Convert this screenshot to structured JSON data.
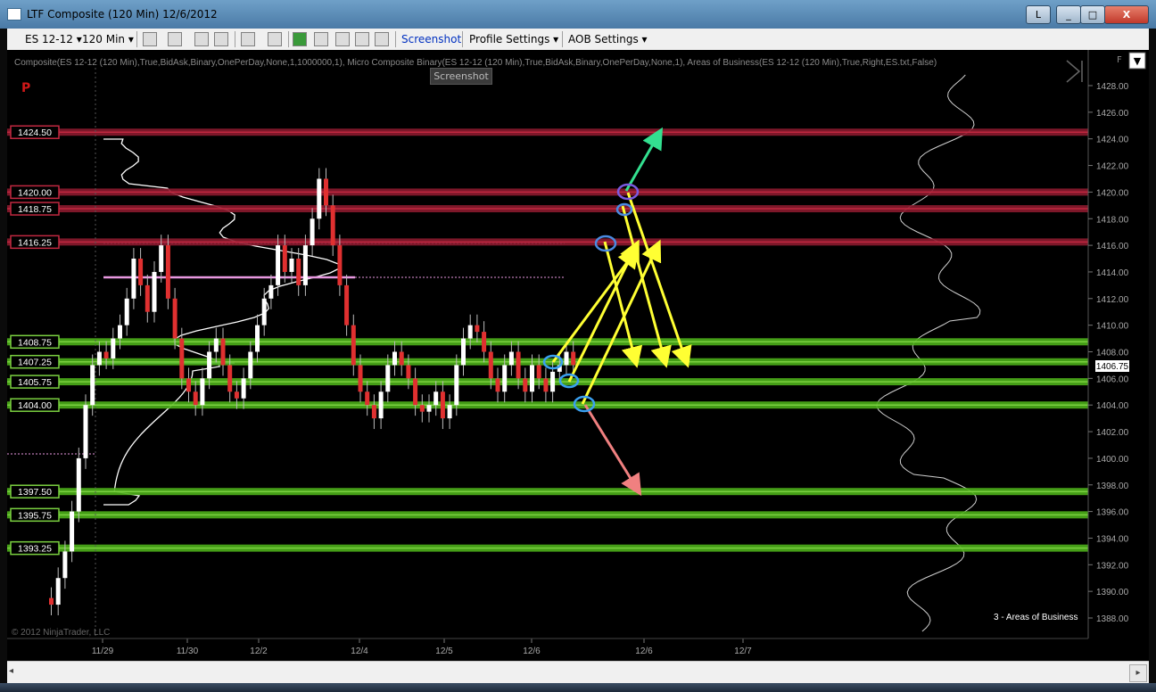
{
  "window": {
    "title": "LTF Composite (120 Min)  12/6/2012",
    "controls": [
      "L",
      "_",
      "□",
      "X"
    ]
  },
  "toolbar": {
    "instrument": "ES 12-12",
    "interval": "120 Min",
    "screenshot_label": "Screenshot",
    "profile_settings_label": "Profile Settings",
    "aob_settings_label": "AOB Settings"
  },
  "chart": {
    "indicator_text": "Composite(ES 12-12 (120 Min),True,BidAsk,Binary,OnePerDay,None,1,1000000,1), Micro Composite Binary(ES 12-12 (120 Min),True,BidAsk,Binary,OnePerDay,None,1), Areas of Business(ES 12-12 (120 Min),True,Right,ES.txt,False)",
    "tooltip": "Screenshot",
    "copyright": "© 2012 NinjaTrader, LLC",
    "panel_label": "3 - Areas of Business",
    "p_badge": "P",
    "f_badge": "F",
    "last_price": "1406.75",
    "date_labels": [
      "11/29",
      "11/30",
      "12/2",
      "12/4",
      "12/5",
      "12/6",
      "12/6",
      "12/7"
    ],
    "price_axis": [
      "1428.00",
      "1426.00",
      "1424.00",
      "1422.00",
      "1420.00",
      "1418.00",
      "1416.00",
      "1414.00",
      "1412.00",
      "1410.00",
      "1408.00",
      "1406.00",
      "1404.00",
      "1402.00",
      "1400.00",
      "1398.00",
      "1396.00",
      "1394.00",
      "1392.00",
      "1390.00",
      "1388.00"
    ],
    "resistance_levels": [
      {
        "label": "1424.50",
        "price": 1424.5
      },
      {
        "label": "1420.00",
        "price": 1420.0
      },
      {
        "label": "1418.75",
        "price": 1418.75
      },
      {
        "label": "1416.25",
        "price": 1416.25
      }
    ],
    "support_levels": [
      {
        "label": "1408.75",
        "price": 1408.75
      },
      {
        "label": "1407.25",
        "price": 1407.25
      },
      {
        "label": "1405.75",
        "price": 1405.75
      },
      {
        "label": "1404.00",
        "price": 1404.0
      },
      {
        "label": "1397.50",
        "price": 1397.5
      },
      {
        "label": "1395.75",
        "price": 1395.75
      },
      {
        "label": "1393.25",
        "price": 1393.25
      }
    ],
    "colors": {
      "resistance": "#8b1a2e",
      "support": "#4caf1a",
      "bull": "#ffffff",
      "bear": "#e03030",
      "scenario": "#ffff33",
      "bull_target": "#33e090",
      "bear_target": "#f08080"
    }
  }
}
